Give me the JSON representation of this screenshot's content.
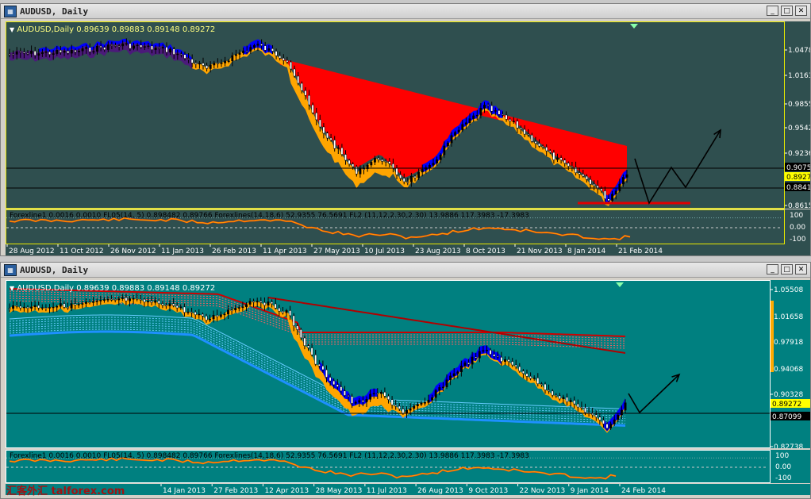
{
  "top": {
    "title": "AUDUSD, Daily",
    "header": "AUDUSD,Daily  0.89639 0.89883 0.89148 0.89272",
    "indicator_text": "Forexline1 0.0016 0.0010  FL05(14, 5) 0.898482 0.89766  Forexlines(14,18,6) 52.9355 76.5691  FL2 (11,12,2.30,2.30) 13.9886 117.3983 -17.3983",
    "price_ticks": [
      "1.0478",
      "1.0163",
      "0.9855",
      "0.9542",
      "0.9236",
      "0.8615"
    ],
    "current_tags": [
      {
        "text": "0.9075",
        "type": "line"
      },
      {
        "text": "0.8927",
        "type": "price"
      },
      {
        "text": "0.8841",
        "type": "line"
      }
    ],
    "sub_ticks": [
      "100",
      "0.00",
      "-100"
    ],
    "dates": [
      "28 Aug 2012",
      "11 Oct 2012",
      "26 Nov 2012",
      "11 Jan 2013",
      "26 Feb 2013",
      "11 Apr 2013",
      "27 May 2013",
      "10 Jul 2013",
      "23 Aug 2013",
      "8 Oct 2013",
      "21 Nov 2013",
      "8 Jan 2014",
      "21 Feb 2014"
    ]
  },
  "bottom": {
    "title": "AUDUSD, Daily",
    "header": "AUDUSD,Daily  0.89639 0.89883 0.89148 0.89272",
    "indicator_text": "Forexline1 0.0016 0.0010  FL05(14, 5) 0.898482 0.89766  Forexlines(14,18,6) 52.9355 76.5691  FL2 (11,12,2.30,2.30) 13.9886 117.3983 -17.3983",
    "price_ticks": [
      "1.05508",
      "1.01658",
      "0.97918",
      "0.94068",
      "0.90328",
      "0.82738"
    ],
    "current_tags": [
      {
        "text": "0.89272",
        "type": "price"
      },
      {
        "text": "0.87099",
        "type": "line"
      }
    ],
    "sub_ticks": [
      "100",
      "0.00",
      "-100"
    ],
    "dates": [
      "14 Jan 2013",
      "27 Feb 2013",
      "12 Apr 2013",
      "28 May 2013",
      "11 Jul 2013",
      "26 Aug 2013",
      "9 Oct 2013",
      "22 Nov 2013",
      "9 Jan 2014",
      "24 Feb 2014"
    ]
  },
  "watermark": "汇客外汇 talforex.com",
  "colors": {
    "top_bg": "#2f4f4f",
    "bottom_bg": "#008080",
    "ribbon_red": "#ff0000",
    "ribbon_orange": "#ffa500",
    "ribbon_blue": "#0000ff",
    "bottom_blue_band": "#3399ff",
    "candle": "#000000",
    "frame_yellow": "#e8e800"
  }
}
